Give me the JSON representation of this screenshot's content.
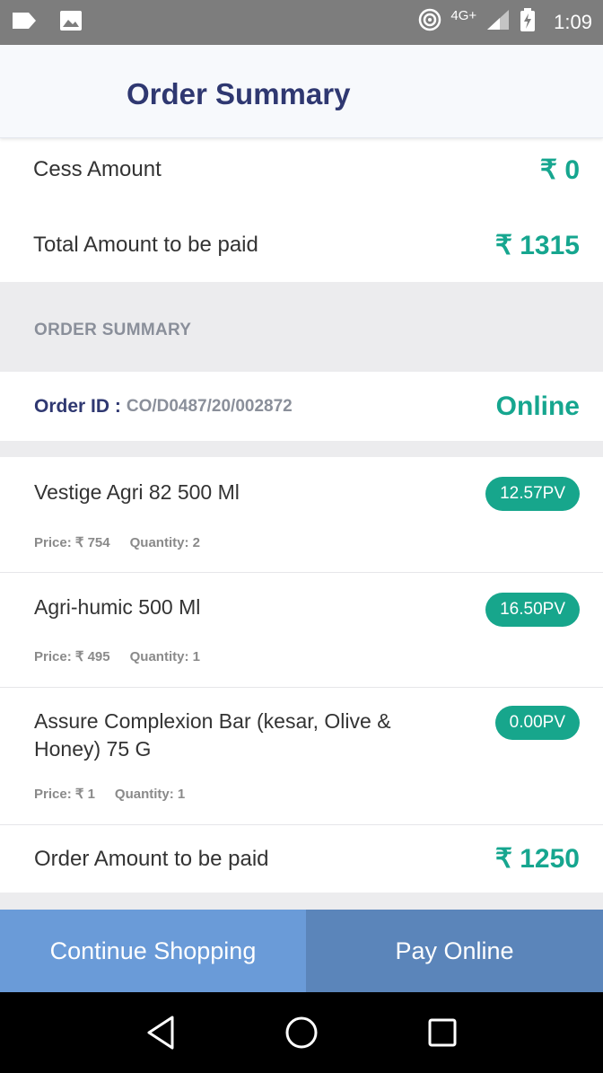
{
  "status_bar": {
    "network": "4G+",
    "time": "1:09"
  },
  "header": {
    "title": "Order Summary"
  },
  "amounts": {
    "cess_label": "Cess Amount",
    "cess_value": "₹ 0",
    "total_label": "Total Amount to be paid",
    "total_value": "₹ 1315"
  },
  "section": {
    "title": "ORDER SUMMARY"
  },
  "order": {
    "id_label": "Order ID :",
    "id_value": "CO/D0487/20/002872",
    "mode": "Online"
  },
  "items": [
    {
      "name": "Vestige Agri 82 500 Ml",
      "price": "Price: ₹ 754",
      "quantity": "Quantity: 2",
      "pv": "12.57PV"
    },
    {
      "name": "Agri-humic  500 Ml",
      "price": "Price: ₹ 495",
      "quantity": "Quantity: 1",
      "pv": "16.50PV"
    },
    {
      "name": "Assure Complexion Bar (kesar, Olive & Honey) 75 G",
      "price": "Price: ₹ 1",
      "quantity": "Quantity: 1",
      "pv": "0.00PV"
    }
  ],
  "order_amount": {
    "label": "Order Amount to be paid",
    "value": "₹ 1250"
  },
  "buttons": {
    "continue_label": "Continue Shopping",
    "pay_label": "Pay Online"
  },
  "colors": {
    "accent_green": "#16a68f",
    "title_navy": "#2f3871",
    "continue_bg": "#6a9bd8",
    "pay_bg": "#5b85ba"
  }
}
